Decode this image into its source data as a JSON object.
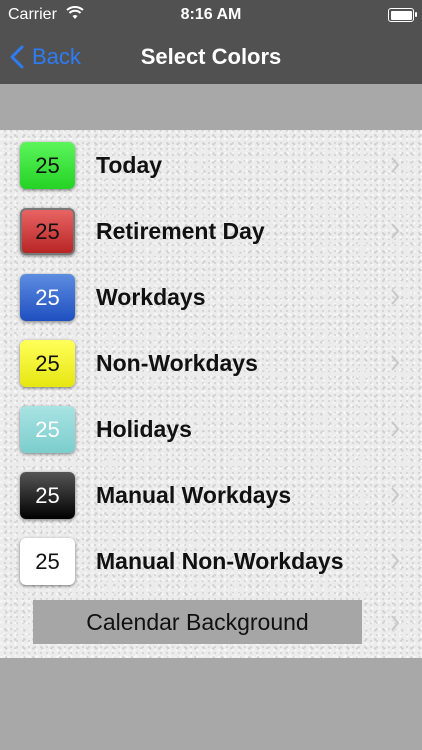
{
  "status_bar": {
    "carrier": "Carrier",
    "time": "8:16 AM"
  },
  "nav": {
    "back_label": "Back",
    "title": "Select Colors"
  },
  "rows": [
    {
      "number": "25",
      "label": "Today",
      "color": "#33e633"
    },
    {
      "number": "25",
      "label": "Retirement Day",
      "color": "#d04444"
    },
    {
      "number": "25",
      "label": "Workdays",
      "color": "#3366cc"
    },
    {
      "number": "25",
      "label": "Non-Workdays",
      "color": "#ffff33"
    },
    {
      "number": "25",
      "label": "Holidays",
      "color": "#8fd6d6"
    },
    {
      "number": "25",
      "label": "Manual Workdays",
      "color": "#000000"
    },
    {
      "number": "25",
      "label": "Manual Non-Workdays",
      "color": "#ffffff"
    }
  ],
  "calendar_background": {
    "label": "Calendar Background"
  },
  "colors": {
    "nav_background": "#515151",
    "accent_blue": "#2d7cf6",
    "list_background": "#ececec",
    "band_gray": "#a8a8a8"
  }
}
